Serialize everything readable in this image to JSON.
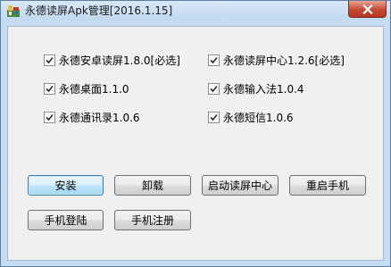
{
  "window": {
    "title": "永德读屏Apk管理[2016.1.15]"
  },
  "checkboxes": [
    {
      "label": "永德安卓读屏1.8.0[必选]",
      "checked": true
    },
    {
      "label": "永德读屏中心1.2.6[必选]",
      "checked": true
    },
    {
      "label": "永德桌面1.1.0",
      "checked": true
    },
    {
      "label": "永德输入法1.0.4",
      "checked": true
    },
    {
      "label": "永德通讯录1.0.6",
      "checked": true
    },
    {
      "label": "永德短信1.0.6",
      "checked": true
    }
  ],
  "buttons": {
    "install": "安装",
    "uninstall": "卸载",
    "start_center": "启动读屏中心",
    "restart_phone": "重启手机",
    "phone_login": "手机登陆",
    "phone_register": "手机注册"
  }
}
